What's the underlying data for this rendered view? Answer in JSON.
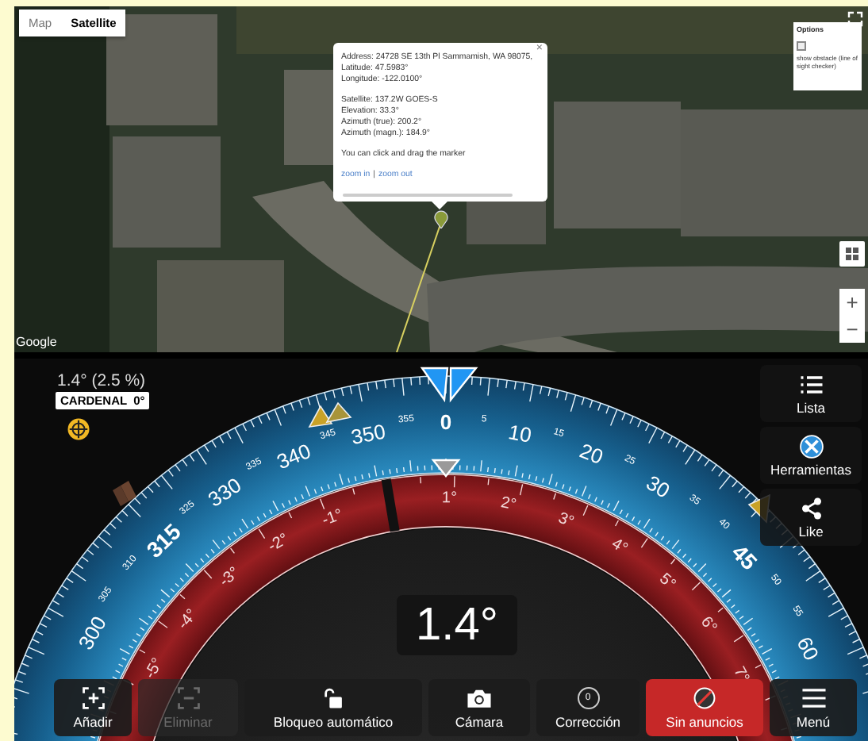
{
  "map": {
    "tabs": [
      {
        "label": "Map",
        "selected": false
      },
      {
        "label": "Satellite",
        "selected": true
      }
    ],
    "options": {
      "title": "Options",
      "show_obstacle": {
        "label": "show obstacle (line of sight checker)",
        "checked": false
      }
    },
    "popup": {
      "close": "×",
      "sections": [
        [
          "Address: 24728 SE 13th Pl Sammamish, WA 98075,",
          "Latitude: 47.5983°",
          "Longitude: -122.0100°"
        ],
        [
          "Satellite: 137.2W GOES-S",
          "Elevation: 33.3°",
          "Azimuth (true): 200.2°",
          "Azimuth (magn.): 184.9°"
        ],
        [
          "You can click and drag the marker"
        ]
      ],
      "links": [
        "zoom in",
        "zoom out"
      ],
      "separator": "|"
    },
    "zoom_controls": [
      "+",
      "−"
    ],
    "attribution": "Google"
  },
  "app": {
    "reading_small": "1.4° (2.5 %)",
    "reference": "CARDENAL  0°",
    "dial": {
      "zero": "0",
      "left": [
        {
          "text": "355",
          "kind": "minor"
        },
        {
          "text": "350",
          "kind": "major"
        },
        {
          "text": "345",
          "kind": "minor"
        },
        {
          "text": "340",
          "kind": "major"
        },
        {
          "text": "335",
          "kind": "minor"
        },
        {
          "text": "330",
          "kind": "major"
        },
        {
          "text": "325",
          "kind": "minor"
        },
        {
          "text": "315",
          "kind": "bold"
        },
        {
          "text": "310",
          "kind": "minor"
        },
        {
          "text": "305",
          "kind": "minor"
        },
        {
          "text": "300",
          "kind": "major"
        }
      ],
      "right": [
        {
          "text": "5",
          "kind": "minor"
        },
        {
          "text": "10",
          "kind": "major"
        },
        {
          "text": "15",
          "kind": "minor"
        },
        {
          "text": "20",
          "kind": "major"
        },
        {
          "text": "25",
          "kind": "minor"
        },
        {
          "text": "30",
          "kind": "major"
        },
        {
          "text": "35",
          "kind": "minor"
        },
        {
          "text": "40",
          "kind": "minor"
        },
        {
          "text": "45",
          "kind": "bold"
        },
        {
          "text": "50",
          "kind": "minor"
        },
        {
          "text": "55",
          "kind": "minor"
        },
        {
          "text": "60",
          "kind": "major"
        }
      ],
      "tilt_negative": [
        "-1°",
        "-2°",
        "-3°",
        "-4°",
        "-5°"
      ],
      "tilt_positive": [
        "1°",
        "2°",
        "3°",
        "4°",
        "5°",
        "6°",
        "7°"
      ]
    },
    "side_buttons": [
      {
        "label": "Lista",
        "kind": "list"
      },
      {
        "label": "Herramientas",
        "kind": "tools"
      },
      {
        "label": "Like",
        "kind": "share"
      }
    ],
    "reading": "1.4°",
    "toolbar": [
      {
        "label": "Añadir",
        "kind": "add",
        "disabled": false,
        "highlighted": false
      },
      {
        "label": "Eliminar",
        "kind": "remove",
        "disabled": true,
        "highlighted": false
      },
      {
        "label": "Bloqueo automático",
        "kind": "lock",
        "disabled": false,
        "highlighted": false
      },
      {
        "label": "Cámara",
        "kind": "camera",
        "disabled": false,
        "highlighted": false
      },
      {
        "label": "Corrección",
        "kind": "correction",
        "icon_text": "0",
        "disabled": false,
        "highlighted": false
      },
      {
        "label": "Sin anuncios",
        "kind": "no-ads",
        "disabled": false,
        "highlighted": true
      },
      {
        "label": "Menú",
        "kind": "menu",
        "disabled": false,
        "highlighted": false
      }
    ]
  }
}
